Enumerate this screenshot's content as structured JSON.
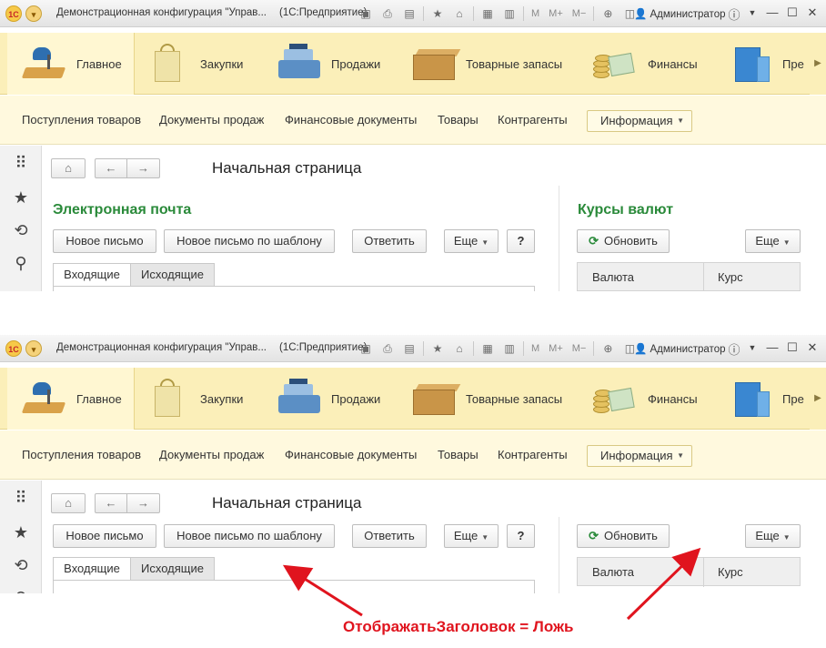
{
  "titlebar": {
    "logo_text": "1С",
    "title": "Демонстрационная конфигурация \"Управ...",
    "app": "(1С:Предприятие)",
    "memory_buttons": [
      "M",
      "M+",
      "M−"
    ],
    "user": "Администратор"
  },
  "sections": [
    {
      "label": "Главное",
      "icon": "desk-lamp-icon"
    },
    {
      "label": "Закупки",
      "icon": "shopping-bag-icon"
    },
    {
      "label": "Продажи",
      "icon": "cash-register-icon"
    },
    {
      "label": "Товарные запасы",
      "icon": "box-icon"
    },
    {
      "label": "Финансы",
      "icon": "coins-icon"
    },
    {
      "label": "Пре",
      "icon": "building-icon"
    }
  ],
  "navbar": {
    "items": [
      "Поступления товаров",
      "Документы продаж",
      "Финансовые документы",
      "Товары",
      "Контрагенты"
    ],
    "dropdown": "Информация"
  },
  "page": {
    "title": "Начальная страница"
  },
  "email_group": {
    "title": "Электронная почта",
    "buttons": [
      "Новое письмо",
      "Новое письмо по шаблону",
      "Ответить",
      "Еще",
      "?"
    ],
    "tabs": [
      "Входящие",
      "Исходящие"
    ]
  },
  "rates_group": {
    "title": "Курсы валют",
    "refresh": "Обновить",
    "more": "Еще",
    "columns": [
      "Валюта",
      "Курс"
    ]
  },
  "annotation": "ОтображатьЗаголовок = Ложь",
  "colors": {
    "section_bar": "#fbefb9",
    "group_title": "#2a8a3a",
    "annotation": "#e0141e"
  }
}
